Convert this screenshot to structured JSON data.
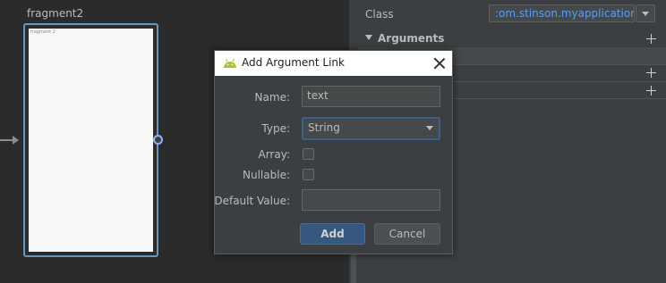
{
  "canvas": {
    "fragment_label": "fragment2",
    "fragment_preview_text": "fragment 2"
  },
  "attributes": {
    "class_label": "Class",
    "class_value": ":om.stinson.myapplication)",
    "section_title": "Arguments"
  },
  "dialog": {
    "title": "Add Argument Link",
    "name_label": "Name:",
    "name_value": "text",
    "type_label": "Type:",
    "type_value": "String",
    "array_label": "Array:",
    "array_checked": false,
    "nullable_label": "Nullable:",
    "nullable_checked": false,
    "default_label": "Default Value:",
    "default_value": "",
    "add_label": "Add",
    "cancel_label": "Cancel"
  },
  "colors": {
    "accent": "#589df6",
    "selection_border": "#6897bb",
    "android_green": "#a4c639",
    "primary_button": "#365880"
  },
  "icons": [
    "android-icon",
    "close-icon",
    "plus-icon",
    "dropdown-arrow-icon",
    "section-collapse-icon"
  ]
}
